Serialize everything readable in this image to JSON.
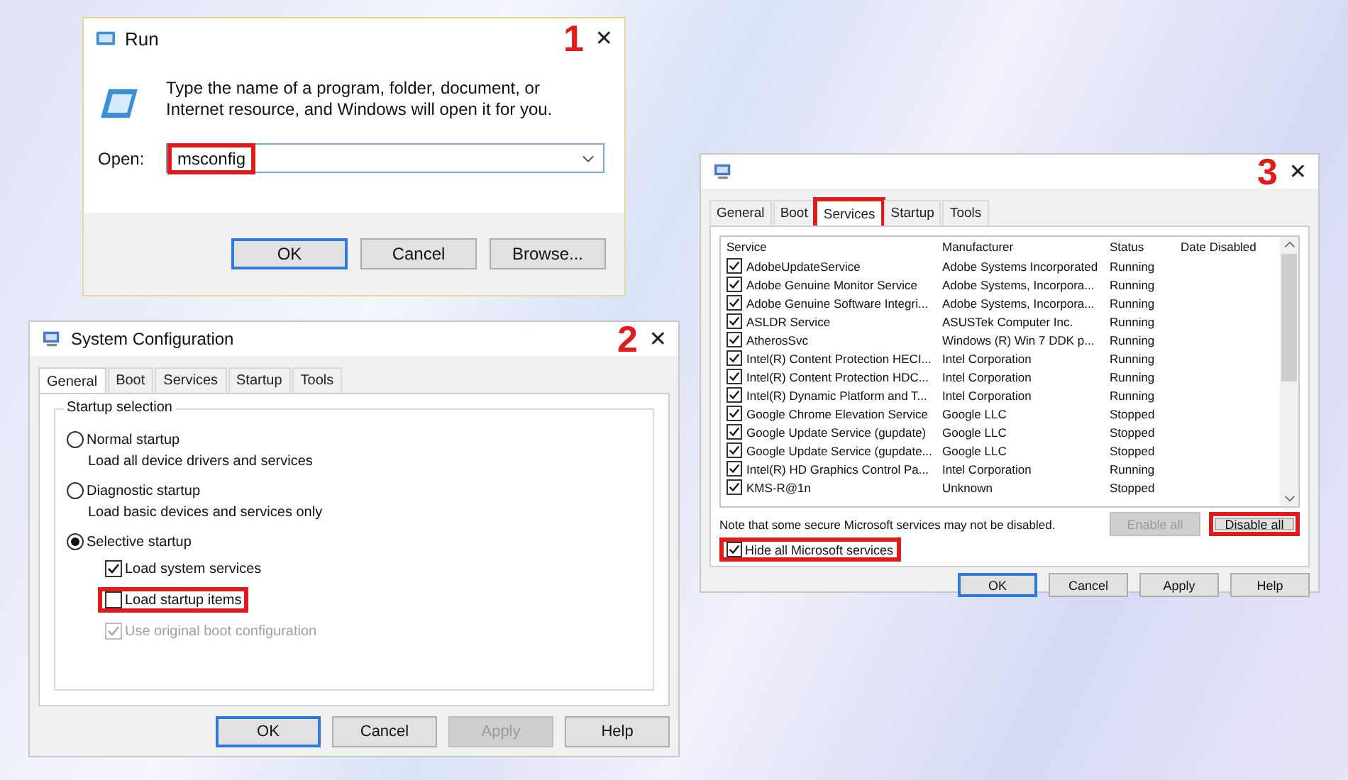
{
  "run_dialog": {
    "step": "1",
    "title": "Run",
    "close": "✕",
    "message": "Type the name of a program, folder, document, or Internet resource, and Windows will open it for you.",
    "open_label": "Open:",
    "open_value": "msconfig",
    "value_highlighted": true,
    "buttons": [
      {
        "label": "OK",
        "default": true
      },
      {
        "label": "Cancel",
        "default": false
      },
      {
        "label": "Browse...",
        "default": false
      }
    ]
  },
  "general_dialog": {
    "step": "2",
    "title": "System Configuration",
    "close": "✕",
    "tabs": [
      {
        "label": "General",
        "selected": true
      },
      {
        "label": "Boot",
        "selected": false
      },
      {
        "label": "Services",
        "selected": false
      },
      {
        "label": "Startup",
        "selected": false
      },
      {
        "label": "Tools",
        "selected": false
      }
    ],
    "group_title": "Startup selection",
    "options": [
      {
        "label": "Normal startup",
        "description": "Load all device drivers and services",
        "selected": false
      },
      {
        "label": "Diagnostic startup",
        "description": "Load basic devices and services only",
        "selected": false
      },
      {
        "label": "Selective startup",
        "selected": true
      }
    ],
    "checkboxes": [
      {
        "label": "Load system services",
        "checked": true,
        "disabled": false,
        "highlighted": false
      },
      {
        "label": "Load startup items",
        "checked": false,
        "disabled": false,
        "highlighted": true
      },
      {
        "label": "Use original boot configuration",
        "checked": true,
        "disabled": true,
        "highlighted": false
      }
    ],
    "buttons": [
      {
        "label": "OK",
        "default": true,
        "disabled": false
      },
      {
        "label": "Cancel",
        "default": false,
        "disabled": false
      },
      {
        "label": "Apply",
        "default": false,
        "disabled": true
      },
      {
        "label": "Help",
        "default": false,
        "disabled": false
      }
    ]
  },
  "services_dialog": {
    "step": "3",
    "close": "✕",
    "tabs": [
      {
        "label": "General",
        "selected": false,
        "highlighted": false
      },
      {
        "label": "Boot",
        "selected": false,
        "highlighted": false
      },
      {
        "label": "Services",
        "selected": true,
        "highlighted": true
      },
      {
        "label": "Startup",
        "selected": false,
        "highlighted": false
      },
      {
        "label": "Tools",
        "selected": false,
        "highlighted": false
      }
    ],
    "columns": [
      "Service",
      "Manufacturer",
      "Status",
      "Date Disabled"
    ],
    "rows": [
      {
        "checked": true,
        "service": "AdobeUpdateService",
        "manufacturer": "Adobe Systems Incorporated",
        "status": "Running"
      },
      {
        "checked": true,
        "service": "Adobe Genuine Monitor Service",
        "manufacturer": "Adobe Systems, Incorpora...",
        "status": "Running"
      },
      {
        "checked": true,
        "service": "Adobe Genuine Software Integri...",
        "manufacturer": "Adobe Systems, Incorpora...",
        "status": "Running"
      },
      {
        "checked": true,
        "service": "ASLDR Service",
        "manufacturer": "ASUSTek Computer Inc.",
        "status": "Running"
      },
      {
        "checked": true,
        "service": "AtherosSvc",
        "manufacturer": "Windows (R) Win 7 DDK p...",
        "status": "Running"
      },
      {
        "checked": true,
        "service": "Intel(R) Content Protection HECI...",
        "manufacturer": "Intel Corporation",
        "status": "Running"
      },
      {
        "checked": true,
        "service": "Intel(R) Content Protection HDC...",
        "manufacturer": "Intel Corporation",
        "status": "Running"
      },
      {
        "checked": true,
        "service": "Intel(R) Dynamic Platform and T...",
        "manufacturer": "Intel Corporation",
        "status": "Running"
      },
      {
        "checked": true,
        "service": "Google Chrome Elevation Service",
        "manufacturer": "Google LLC",
        "status": "Stopped"
      },
      {
        "checked": true,
        "service": "Google Update Service (gupdate)",
        "manufacturer": "Google LLC",
        "status": "Stopped"
      },
      {
        "checked": true,
        "service": "Google Update Service (gupdate...",
        "manufacturer": "Google LLC",
        "status": "Stopped"
      },
      {
        "checked": true,
        "service": "Intel(R) HD Graphics Control Pa...",
        "manufacturer": "Intel Corporation",
        "status": "Running"
      },
      {
        "checked": true,
        "service": "KMS-R@1n",
        "manufacturer": "Unknown",
        "status": "Stopped"
      }
    ],
    "note": "Note that some secure Microsoft services may not be disabled.",
    "action_buttons": [
      {
        "label": "Enable all",
        "disabled": true,
        "highlighted": false
      },
      {
        "label": "Disable all",
        "disabled": false,
        "highlighted": true
      }
    ],
    "hide_microsoft": {
      "label": "Hide all Microsoft services",
      "checked": true,
      "highlighted": true
    },
    "buttons": [
      {
        "label": "OK",
        "default": true,
        "disabled": false
      },
      {
        "label": "Cancel",
        "default": false,
        "disabled": false
      },
      {
        "label": "Apply",
        "default": false,
        "disabled": false
      },
      {
        "label": "Help",
        "default": false,
        "disabled": false
      }
    ]
  }
}
